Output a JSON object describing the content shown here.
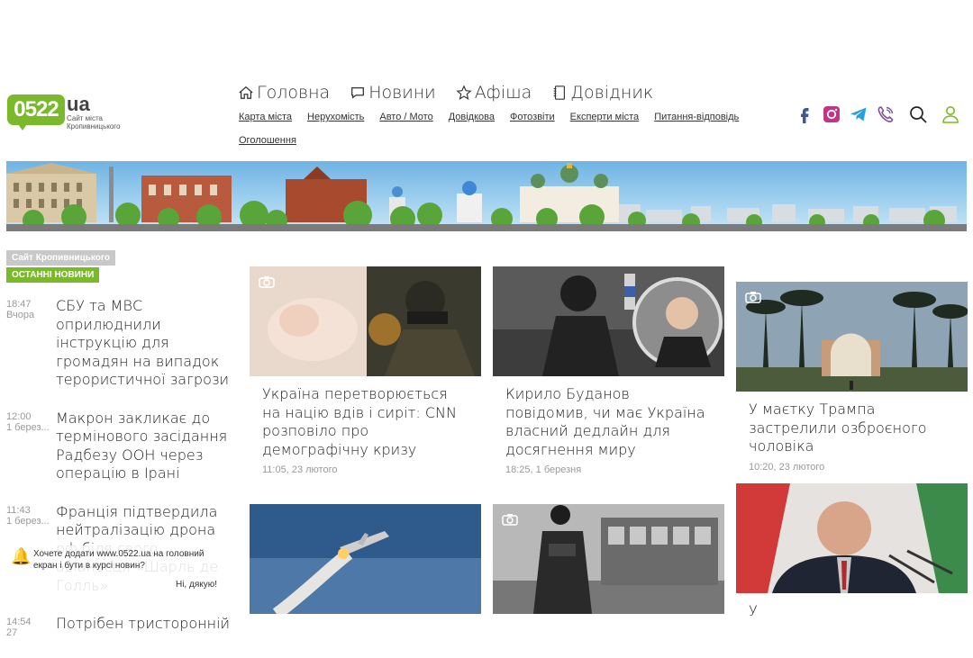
{
  "logo": {
    "main": "0522",
    "suffix": "ua",
    "subtitle": "Сайт міста Кропивницького"
  },
  "main_nav": [
    {
      "label": "Головна",
      "icon": "home-icon"
    },
    {
      "label": "Новини",
      "icon": "chat-icon"
    },
    {
      "label": "Афіша",
      "icon": "star-icon"
    },
    {
      "label": "Довідник",
      "icon": "book-icon"
    }
  ],
  "sub_nav": [
    "Карта міста",
    "Нерухомість",
    "Авто / Мото",
    "Довідкова",
    "Фотозвіти",
    "Експерти міста",
    "Питання-відповідь",
    "Оголошення"
  ],
  "social": [
    "facebook-icon",
    "instagram-icon",
    "telegram-icon",
    "viber-icon",
    "search-icon",
    "user-icon"
  ],
  "colors": {
    "brand_green": "#7ab929",
    "facebook": "#3b5998",
    "instagram": "#c13584",
    "telegram": "#2aa0da",
    "viber": "#7b519d"
  },
  "sidebar": {
    "tag_site": "Сайт Кропивницького",
    "tag_latest": "ОСТАННІ НОВИНИ",
    "items": [
      {
        "time": "18:47",
        "date": "Вчора",
        "title": "СБУ та МВС оприлюднили інструкцію для громадян на випадок терористичної загрози"
      },
      {
        "time": "12:00",
        "date": "1 берез...",
        "title": "Макрон закликає до термінового засідання Радбезу ООН через операцію в Ірані"
      },
      {
        "time": "11:43",
        "date": "1 берез...",
        "title": "Франція підтвердила нейтралізацію дрона рф біля свого авіаносця «Шарль де Голль»"
      },
      {
        "time": "14:54",
        "date": "27",
        "title": "Потрібен тристоронній"
      }
    ]
  },
  "notification": {
    "text": "Хочете додати www.0522.ua на головний екран і бути в курсі новин?",
    "button": "Ні, дякую!"
  },
  "cards": [
    {
      "title": "Україна перетворюється на націю вдів і сиріт: CNN розповіло про демографічну кризу",
      "date": "11:05, 23 лютого",
      "photo": true
    },
    {
      "title": "Кирило Буданов повідомив, чи має Україна власний дедлайн для досягнення миру",
      "date": "18:25, 1 березня",
      "photo": false
    },
    {
      "title": "У маєтку Трампа застрелили озброєного чоловіка",
      "date": "10:20, 23 лютого",
      "photo": true
    },
    {
      "title": "",
      "date": "",
      "photo": false
    },
    {
      "title": "",
      "date": "",
      "photo": true
    },
    {
      "title": "У",
      "date": "",
      "photo": false
    }
  ]
}
